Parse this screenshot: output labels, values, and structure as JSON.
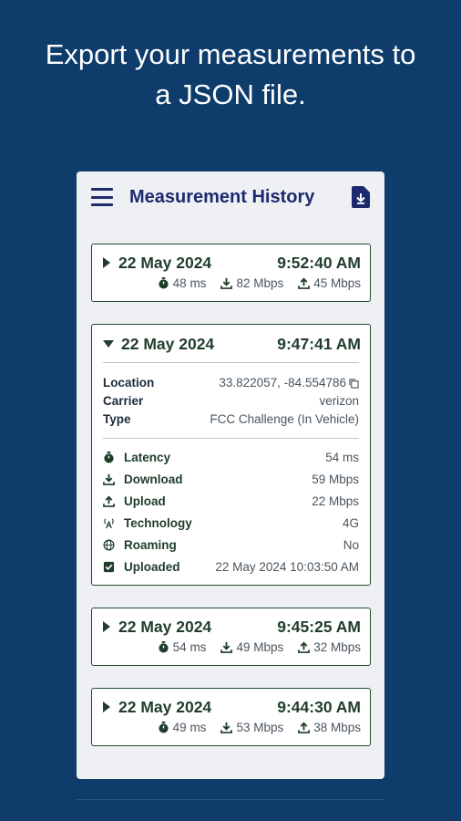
{
  "headline": {
    "line1": "Export your measurements to",
    "line2": "a JSON file."
  },
  "appbar": {
    "title": "Measurement History",
    "menu_icon": "hamburger-menu-icon",
    "export_icon": "file-download-icon"
  },
  "cards": [
    {
      "date": "22 May 2024",
      "time": "9:52:40 AM",
      "latency": "48 ms",
      "download": "82 Mbps",
      "upload": "45 Mbps",
      "expanded": false
    },
    {
      "date": "22 May 2024",
      "time": "9:47:41 AM",
      "expanded": true,
      "location_label": "Location",
      "location": "33.822057, -84.554786",
      "carrier_label": "Carrier",
      "carrier": "verizon",
      "type_label": "Type",
      "type": "FCC Challenge (In Vehicle)",
      "latency_label": "Latency",
      "latency": "54 ms",
      "download_label": "Download",
      "download": "59 Mbps",
      "upload_label": "Upload",
      "upload": "22 Mbps",
      "technology_label": "Technology",
      "technology": "4G",
      "roaming_label": "Roaming",
      "roaming": "No",
      "uploaded_label": "Uploaded",
      "uploaded": "22 May 2024 10:03:50 AM"
    },
    {
      "date": "22 May 2024",
      "time": "9:45:25 AM",
      "latency": "54 ms",
      "download": "49 Mbps",
      "upload": "32 Mbps",
      "expanded": false
    },
    {
      "date": "22 May 2024",
      "time": "9:44:30 AM",
      "latency": "49 ms",
      "download": "53 Mbps",
      "upload": "38 Mbps",
      "expanded": false
    }
  ],
  "colors": {
    "background": "#0e3d6c",
    "card_border": "#1f4a2c",
    "accent_text": "#1f3d2a",
    "appbar_title": "#1d2b6e"
  }
}
